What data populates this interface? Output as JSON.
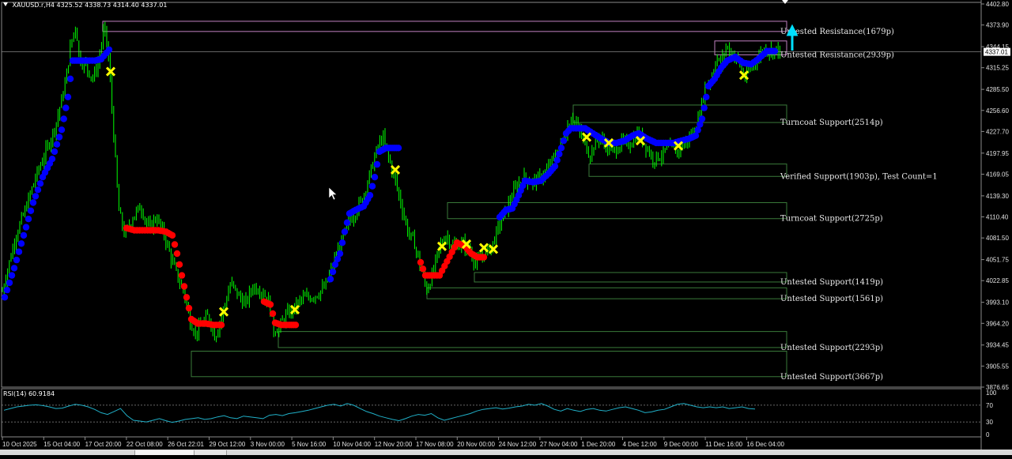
{
  "header": {
    "symbol": "XAUUSD.r,H4",
    "ohlc": "4325.52 4338.73 4314.40 4337.01",
    "rsi_label": "RSI(14) 60.9184"
  },
  "colors": {
    "background": "#000000",
    "candle": "#00ff00",
    "bull_dots": "#0000ff",
    "bear_dots": "#ff0000",
    "cross": "#ffff00",
    "zone": "#3a7a3a",
    "resistance_zone": "#c080c0",
    "rsi": "#20b0c8",
    "arrow": "#00e0ff"
  },
  "chart_data": [
    {
      "type": "candlestick",
      "symbol": "XAUUSD.r",
      "timeframe": "H4",
      "last_close": 4337.01,
      "ylim": [
        3876.65,
        4402.8
      ],
      "y_ticks": [
        4402.8,
        4373.9,
        4344.15,
        4315.25,
        4285.5,
        4256.6,
        4227.7,
        4197.95,
        4169.05,
        4139.3,
        4110.4,
        4081.5,
        4051.75,
        4022.85,
        3993.1,
        3964.2,
        3934.45,
        3905.55,
        3876.65
      ],
      "current_price_label": "4337.01",
      "x_ticks": [
        "10 Oct 2025",
        "15 Oct 04:00",
        "17 Oct 20:00",
        "22 Oct 08:00",
        "26 Oct 22:01",
        "29 Oct 12:00",
        "3 Nov 00:00",
        "5 Nov 16:00",
        "10 Nov 04:00",
        "12 Nov 20:00",
        "17 Nov 08:00",
        "20 Nov 00:00",
        "24 Nov 12:00",
        "27 Nov 04:00",
        "1 Dec 20:00",
        "4 Dec 12:00",
        "9 Dec 00:00",
        "11 Dec 16:00",
        "16 Dec 04:00"
      ],
      "price_path": [
        [
          0,
          3995
        ],
        [
          10,
          4040
        ],
        [
          20,
          4085
        ],
        [
          32,
          4120
        ],
        [
          45,
          4165
        ],
        [
          58,
          4200
        ],
        [
          70,
          4235
        ],
        [
          82,
          4290
        ],
        [
          90,
          4350
        ],
        [
          96,
          4375
        ],
        [
          100,
          4330
        ],
        [
          108,
          4318
        ],
        [
          118,
          4300
        ],
        [
          126,
          4330
        ],
        [
          132,
          4372
        ],
        [
          138,
          4320
        ],
        [
          144,
          4220
        ],
        [
          150,
          4120
        ],
        [
          158,
          4085
        ],
        [
          168,
          4110
        ],
        [
          178,
          4125
        ],
        [
          188,
          4095
        ],
        [
          198,
          4110
        ],
        [
          208,
          4085
        ],
        [
          216,
          4055
        ],
        [
          224,
          4030
        ],
        [
          232,
          4010
        ],
        [
          240,
          3968
        ],
        [
          248,
          3950
        ],
        [
          256,
          3965
        ],
        [
          264,
          3975
        ],
        [
          272,
          3945
        ],
        [
          282,
          3980
        ],
        [
          292,
          4020
        ],
        [
          300,
          4005
        ],
        [
          310,
          3990
        ],
        [
          320,
          4015
        ],
        [
          330,
          4010
        ],
        [
          340,
          3995
        ],
        [
          346,
          3955
        ],
        [
          354,
          3960
        ],
        [
          362,
          3975
        ],
        [
          372,
          3985
        ],
        [
          382,
          3998
        ],
        [
          392,
          4000
        ],
        [
          402,
          4005
        ],
        [
          412,
          4015
        ],
        [
          420,
          4040
        ],
        [
          430,
          4070
        ],
        [
          440,
          4100
        ],
        [
          450,
          4118
        ],
        [
          460,
          4140
        ],
        [
          468,
          4170
        ],
        [
          476,
          4200
        ],
        [
          484,
          4220
        ],
        [
          492,
          4190
        ],
        [
          500,
          4160
        ],
        [
          508,
          4125
        ],
        [
          516,
          4090
        ],
        [
          524,
          4075
        ],
        [
          532,
          4040
        ],
        [
          540,
          4010
        ],
        [
          548,
          4035
        ],
        [
          556,
          4070
        ],
        [
          564,
          4085
        ],
        [
          574,
          4070
        ],
        [
          584,
          4075
        ],
        [
          594,
          4065
        ],
        [
          602,
          4045
        ],
        [
          612,
          4060
        ],
        [
          622,
          4070
        ],
        [
          632,
          4100
        ],
        [
          642,
          4125
        ],
        [
          652,
          4150
        ],
        [
          662,
          4165
        ],
        [
          672,
          4158
        ],
        [
          682,
          4162
        ],
        [
          692,
          4175
        ],
        [
          700,
          4190
        ],
        [
          708,
          4205
        ],
        [
          716,
          4225
        ],
        [
          722,
          4250
        ],
        [
          730,
          4235
        ],
        [
          738,
          4215
        ],
        [
          746,
          4195
        ],
        [
          756,
          4220
        ],
        [
          766,
          4210
        ],
        [
          776,
          4200
        ],
        [
          786,
          4212
        ],
        [
          796,
          4210
        ],
        [
          806,
          4225
        ],
        [
          816,
          4210
        ],
        [
          826,
          4190
        ],
        [
          836,
          4195
        ],
        [
          846,
          4205
        ],
        [
          856,
          4200
        ],
        [
          866,
          4210
        ],
        [
          876,
          4225
        ],
        [
          884,
          4245
        ],
        [
          892,
          4290
        ],
        [
          900,
          4300
        ],
        [
          906,
          4330
        ],
        [
          912,
          4318
        ],
        [
          918,
          4345
        ],
        [
          926,
          4335
        ],
        [
          934,
          4325
        ],
        [
          942,
          4300
        ],
        [
          950,
          4315
        ],
        [
          958,
          4328
        ],
        [
          966,
          4340
        ],
        [
          974,
          4338
        ],
        [
          982,
          4340
        ],
        [
          988,
          4337
        ]
      ],
      "dot_series": [
        {
          "color": "blue",
          "points": [
            [
              6,
              4000
            ],
            [
              18,
              4040
            ],
            [
              30,
              4085
            ],
            [
              42,
              4130
            ],
            [
              54,
              4165
            ],
            [
              66,
              4190
            ],
            [
              78,
              4230
            ],
            [
              86,
              4275
            ],
            [
              92,
              4325
            ],
            [
              100,
              4325
            ],
            [
              110,
              4325
            ],
            [
              120,
              4325
            ],
            [
              128,
              4327
            ],
            [
              138,
              4340
            ]
          ]
        },
        {
          "color": "red",
          "points": [
            [
              160,
              4095
            ],
            [
              170,
              4092
            ],
            [
              180,
              4092
            ],
            [
              190,
              4092
            ],
            [
              200,
              4092
            ],
            [
              210,
              4090
            ],
            [
              218,
              4085
            ],
            [
              224,
              4060
            ],
            [
              230,
              4030
            ],
            [
              236,
              4000
            ],
            [
              242,
              3970
            ],
            [
              250,
              3964
            ],
            [
              260,
              3964
            ],
            [
              270,
              3962
            ],
            [
              280,
              3962
            ]
          ]
        },
        {
          "color": "red",
          "points": [
            [
              334,
              3994
            ],
            [
              342,
              3990
            ],
            [
              348,
              3965
            ],
            [
              356,
              3962
            ],
            [
              366,
              3962
            ],
            [
              374,
              3962
            ]
          ]
        },
        {
          "color": "blue",
          "points": [
            [
              418,
              4025
            ],
            [
              424,
              4045
            ],
            [
              430,
              4060
            ],
            [
              436,
              4090
            ],
            [
              442,
              4115
            ],
            [
              450,
              4120
            ],
            [
              460,
              4125
            ],
            [
              468,
              4140
            ],
            [
              474,
              4165
            ],
            [
              480,
              4200
            ],
            [
              488,
              4205
            ],
            [
              496,
              4205
            ],
            [
              504,
              4205
            ]
          ]
        },
        {
          "color": "red",
          "points": [
            [
              532,
              4048
            ],
            [
              538,
              4030
            ],
            [
              546,
              4030
            ],
            [
              556,
              4030
            ],
            [
              578,
              4075
            ],
            [
              588,
              4070
            ],
            [
              596,
              4060
            ],
            [
              604,
              4055
            ],
            [
              612,
              4055
            ]
          ]
        },
        {
          "color": "blue",
          "points": [
            [
              632,
              4110
            ],
            [
              640,
              4120
            ],
            [
              648,
              4122
            ],
            [
              656,
              4140
            ],
            [
              664,
              4160
            ],
            [
              674,
              4158
            ],
            [
              684,
              4160
            ],
            [
              694,
              4170
            ],
            [
              702,
              4180
            ],
            [
              710,
              4205
            ],
            [
              716,
              4225
            ],
            [
              722,
              4232
            ],
            [
              732,
              4232
            ],
            [
              740,
              4232
            ],
            [
              750,
              4225
            ],
            [
              760,
              4218
            ],
            [
              770,
              4212
            ],
            [
              780,
              4212
            ],
            [
              790,
              4215
            ],
            [
              800,
              4222
            ],
            [
              808,
              4225
            ],
            [
              818,
              4218
            ],
            [
              830,
              4212
            ],
            [
              842,
              4212
            ],
            [
              852,
              4212
            ],
            [
              862,
              4215
            ],
            [
              872,
              4218
            ],
            [
              880,
              4222
            ],
            [
              888,
              4245
            ],
            [
              896,
              4290
            ],
            [
              904,
              4300
            ],
            [
              912,
              4315
            ],
            [
              920,
              4325
            ],
            [
              930,
              4330
            ],
            [
              940,
              4322
            ],
            [
              950,
              4320
            ],
            [
              960,
              4328
            ],
            [
              970,
              4338
            ],
            [
              980,
              4338
            ]
          ]
        }
      ],
      "cross_markers": [
        [
          140,
          4310
        ],
        [
          283,
          3980
        ],
        [
          373,
          3983
        ],
        [
          500,
          4175
        ],
        [
          559,
          4070
        ],
        [
          590,
          4073
        ],
        [
          612,
          4068
        ],
        [
          624,
          4066
        ],
        [
          742,
          4220
        ],
        [
          770,
          4212
        ],
        [
          810,
          4215
        ],
        [
          858,
          4208
        ],
        [
          941,
          4305
        ]
      ],
      "zones": [
        {
          "label": "Untested Resistance(1679p)",
          "x_start": 130,
          "top": 4379,
          "bottom": 4365,
          "kind": "resistance"
        },
        {
          "label": "Untested Resistance(2939p)",
          "x_start": 904,
          "top": 4352,
          "bottom": 4333,
          "kind": "resistance"
        },
        {
          "label": "Turncoat Support(2514p)",
          "x_start": 725,
          "top": 4264,
          "bottom": 4240,
          "kind": "support"
        },
        {
          "label": "Verified Support(1903p), Test Count=1",
          "x_start": 745,
          "top": 4183,
          "bottom": 4166,
          "kind": "support"
        },
        {
          "label": "Turncoat Support(2725p)",
          "x_start": 566,
          "top": 4130,
          "bottom": 4108,
          "kind": "support"
        },
        {
          "label": "Untested Support(1419p)",
          "x_start": 600,
          "top": 4034,
          "bottom": 4021,
          "kind": "support"
        },
        {
          "label": "Untested Support(1561p)",
          "x_start": 540,
          "top": 4013,
          "bottom": 3998,
          "kind": "support"
        },
        {
          "label": "Untested Support(2293p)",
          "x_start": 352,
          "top": 3953,
          "bottom": 3931,
          "kind": "support"
        },
        {
          "label": "Untested Support(3667p)",
          "x_start": 242,
          "top": 3926,
          "bottom": 3891,
          "kind": "support"
        }
      ]
    },
    {
      "type": "line",
      "name": "RSI(14) 60.9184",
      "last_value": 60.9184,
      "ylim": [
        0,
        100
      ],
      "y_ticks": [
        100,
        70,
        30,
        0
      ],
      "levels": [
        70,
        30
      ],
      "values": [
        58,
        62,
        66,
        68,
        70,
        71,
        69,
        66,
        62,
        63,
        68,
        72,
        70,
        66,
        60,
        52,
        48,
        55,
        62,
        45,
        34,
        32,
        30,
        34,
        38,
        33,
        29,
        32,
        36,
        38,
        40,
        36,
        38,
        42,
        45,
        40,
        38,
        44,
        42,
        40,
        38,
        46,
        48,
        45,
        50,
        52,
        55,
        58,
        62,
        66,
        70,
        72,
        68,
        74,
        70,
        62,
        55,
        50,
        44,
        40,
        36,
        33,
        38,
        44,
        48,
        46,
        50,
        40,
        34,
        38,
        42,
        46,
        50,
        56,
        60,
        62,
        64,
        61,
        63,
        66,
        68,
        72,
        70,
        74,
        68,
        60,
        56,
        62,
        58,
        55,
        60,
        62,
        58,
        56,
        60,
        64,
        66,
        62,
        58,
        52,
        54,
        58,
        60,
        66,
        72,
        74,
        70,
        66,
        64,
        66,
        64,
        66,
        62,
        64,
        66,
        62,
        61
      ]
    }
  ]
}
